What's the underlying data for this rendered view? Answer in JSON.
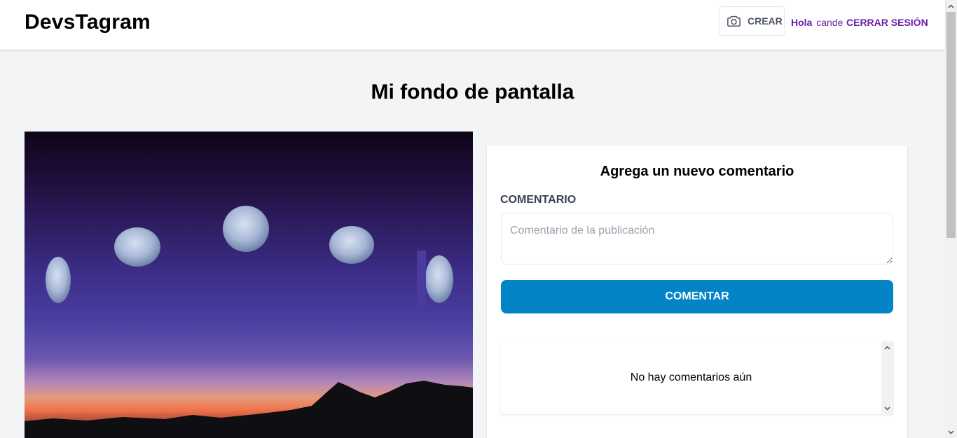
{
  "app": {
    "logo": "DevsTagram"
  },
  "header": {
    "create_label": "CREAR",
    "greeting_prefix": "Hola",
    "username": "cande",
    "logout_label": "CERRAR SESIÓN"
  },
  "post": {
    "title": "Mi fondo de pantalla"
  },
  "comment_form": {
    "title": "Agrega un nuevo comentario",
    "field_label": "Comentario",
    "placeholder": "Comentario de la publicación",
    "value": "",
    "submit_label": "Comentar"
  },
  "comments": {
    "empty_message": "No hay comentarios aún",
    "items": []
  },
  "icons": {
    "create": "camera-icon",
    "scroll_up": "chevron-up-icon",
    "scroll_down": "chevron-down-icon"
  },
  "colors": {
    "accent_purple": "#6b21a8",
    "button_blue": "#0284c7",
    "page_bg": "#f3f4f6"
  }
}
